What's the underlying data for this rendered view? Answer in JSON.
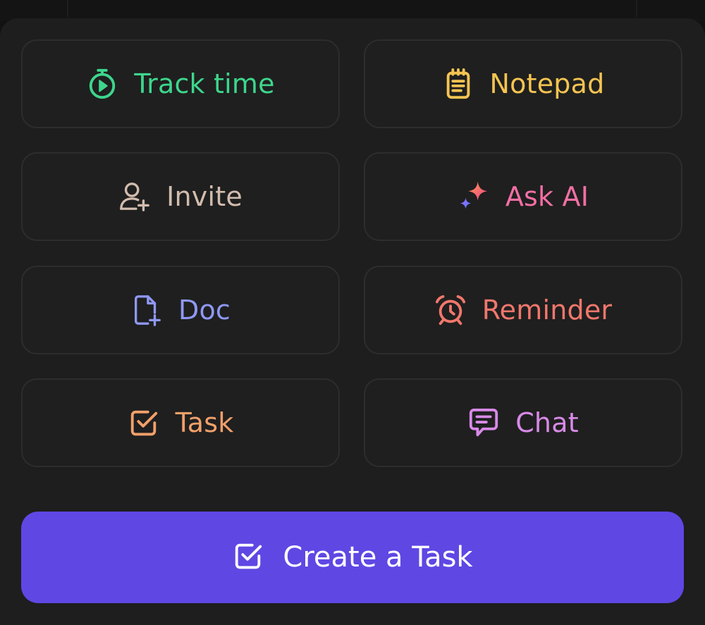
{
  "actions": {
    "track_time": {
      "label": "Track time",
      "color": "#3dd68c",
      "icon": "stopwatch-play-icon"
    },
    "notepad": {
      "label": "Notepad",
      "color": "#f5c451",
      "icon": "notepad-icon"
    },
    "invite": {
      "label": "Invite",
      "color": "#d2bcae",
      "icon": "user-plus-icon"
    },
    "ask_ai": {
      "label": "Ask AI",
      "color": "#f46fa5",
      "icon": "sparkles-icon"
    },
    "doc": {
      "label": "Doc",
      "color": "#8f98f5",
      "icon": "doc-plus-icon"
    },
    "reminder": {
      "label": "Reminder",
      "color": "#f2776c",
      "icon": "alarm-clock-icon"
    },
    "task": {
      "label": "Task",
      "color": "#f3a06a",
      "icon": "checkbox-icon"
    },
    "chat": {
      "label": "Chat",
      "color": "#d88ae8",
      "icon": "chat-bubble-icon"
    }
  },
  "primary_button": {
    "label": "Create a Task",
    "background": "#5f47e4",
    "icon": "checkbox-icon"
  }
}
